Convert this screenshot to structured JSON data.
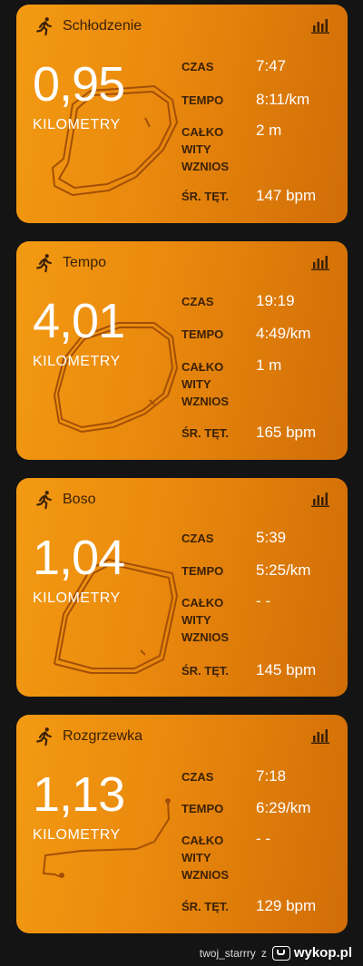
{
  "activities": [
    {
      "title": "Schłodzenie",
      "distance": "0,95",
      "unit": "KILOMETRY",
      "labels": {
        "time": "CZAS",
        "pace": "TEMPO",
        "elev_1": "CAŁKO",
        "elev_2": "WITY",
        "elev_3": "WZNIOS",
        "hr": "ŚR. TĘT."
      },
      "time": "7:47",
      "pace": "8:11/km",
      "elevation": "2 m",
      "avg_hr": "147 bpm"
    },
    {
      "title": "Tempo",
      "distance": "4,01",
      "unit": "KILOMETRY",
      "labels": {
        "time": "CZAS",
        "pace": "TEMPO",
        "elev_1": "CAŁKO",
        "elev_2": "WITY",
        "elev_3": "WZNIOS",
        "hr": "ŚR. TĘT."
      },
      "time": "19:19",
      "pace": "4:49/km",
      "elevation": "1 m",
      "avg_hr": "165 bpm"
    },
    {
      "title": "Boso",
      "distance": "1,04",
      "unit": "KILOMETRY",
      "labels": {
        "time": "CZAS",
        "pace": "TEMPO",
        "elev_1": "CAŁKO",
        "elev_2": "WITY",
        "elev_3": "WZNIOS",
        "hr": "ŚR. TĘT."
      },
      "time": "5:39",
      "pace": "5:25/km",
      "elevation": "- -",
      "avg_hr": "145 bpm"
    },
    {
      "title": "Rozgrzewka",
      "distance": "1,13",
      "unit": "KILOMETRY",
      "labels": {
        "time": "CZAS",
        "pace": "TEMPO",
        "elev_1": "CAŁKO",
        "elev_2": "WITY",
        "elev_3": "WZNIOS",
        "hr": "ŚR. TĘT."
      },
      "time": "7:18",
      "pace": "6:29/km",
      "elevation": "- -",
      "avg_hr": "129 bpm"
    }
  ],
  "footer": {
    "user": "twoj_starrry",
    "connector": "z",
    "site": "wykop.pl"
  },
  "colors": {
    "card_start": "#f39a12",
    "card_end": "#d06d07",
    "label_text": "#3b2106",
    "background": "#141414"
  },
  "icons": {
    "activity": "running-person-icon",
    "stats": "bar-chart-icon",
    "site": "wykop-logo-icon"
  }
}
